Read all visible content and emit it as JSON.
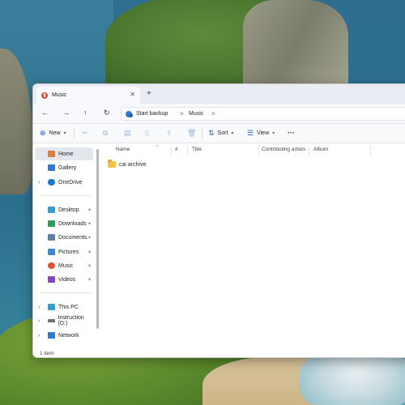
{
  "window": {
    "tab_title": "Music",
    "tab_close": "✕",
    "new_tab": "+"
  },
  "nav": {
    "back": "←",
    "forward": "→",
    "up": "↑",
    "refresh": "↻",
    "address_parts": [
      "Start backup",
      "Music"
    ],
    "chevron": ">"
  },
  "commands": {
    "new_label": "New",
    "sort_label": "Sort",
    "view_label": "View",
    "more_label": "···"
  },
  "sidebar": {
    "items": [
      {
        "label": "Home",
        "icon": "home-icon",
        "color": "#e07b3a"
      },
      {
        "label": "Gallery",
        "icon": "gallery-icon",
        "color": "#2f7bd4"
      },
      {
        "label": "OneDrive",
        "icon": "cloud-icon",
        "color": "#1b76d2"
      },
      {
        "label": "Desktop",
        "icon": "desktop-icon",
        "color": "#2f9ed6"
      },
      {
        "label": "Downloads",
        "icon": "download-icon",
        "color": "#2e9c5b"
      },
      {
        "label": "Documents",
        "icon": "document-icon",
        "color": "#5f7ea6"
      },
      {
        "label": "Pictures",
        "icon": "pictures-icon",
        "color": "#3a8ad6"
      },
      {
        "label": "Music",
        "icon": "music-icon",
        "color": "#e0503a"
      },
      {
        "label": "Videos",
        "icon": "video-icon",
        "color": "#8a45c4"
      },
      {
        "label": "This PC",
        "icon": "pc-icon",
        "color": "#2f9ed6"
      },
      {
        "label": "Instruction (D:)",
        "icon": "drive-icon",
        "color": "#6f6f6f"
      },
      {
        "label": "Network",
        "icon": "network-icon",
        "color": "#2f7bd4"
      }
    ],
    "pin": "📌"
  },
  "columns": [
    "Name",
    "#",
    "Title",
    "Contributing artists",
    "Album"
  ],
  "files": [
    {
      "name": "cai archive",
      "type": "folder"
    }
  ],
  "status": {
    "count": "1 item"
  }
}
